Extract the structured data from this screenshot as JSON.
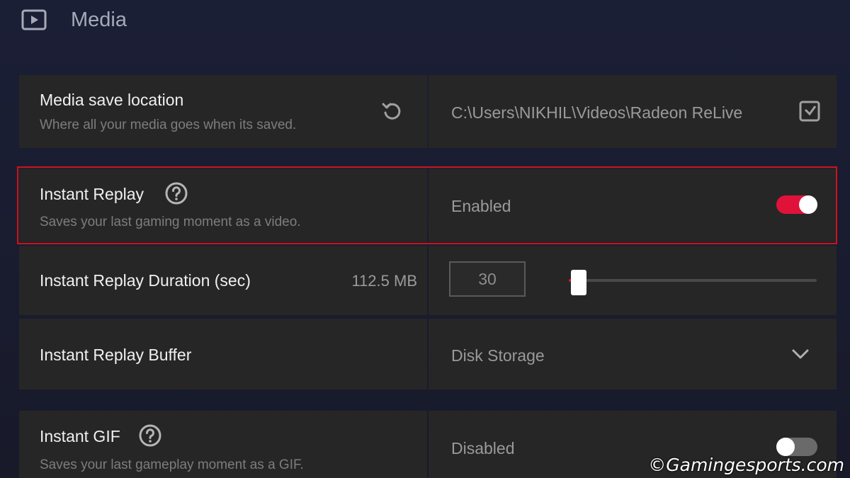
{
  "section": {
    "title": "Media",
    "icon": "play-icon"
  },
  "media_save": {
    "title": "Media save location",
    "subtitle": "Where all your media goes when its saved.",
    "reset_icon": "reset-icon",
    "path": "C:\\Users\\NIKHIL\\Videos\\Radeon ReLive",
    "browse_icon": "folder-browse-icon"
  },
  "instant_replay": {
    "title": "Instant Replay",
    "subtitle": "Saves your last gaming moment as a video.",
    "help_icon": "help-icon",
    "status": "Enabled",
    "toggle_on": true,
    "toggle_color": "#e0123a"
  },
  "replay_duration": {
    "title": "Instant Replay Duration (sec)",
    "size": "112.5 MB",
    "value": "30",
    "slider_fraction": 0.04
  },
  "replay_buffer": {
    "title": "Instant Replay Buffer",
    "value": "Disk Storage",
    "dropdown_icon": "chevron-down-icon"
  },
  "instant_gif": {
    "title": "Instant GIF",
    "subtitle": "Saves your last gameplay moment as a GIF.",
    "help_icon": "help-icon",
    "status": "Disabled",
    "toggle_on": false
  },
  "highlight_color": "#d0121b",
  "watermark": "©Gamingesports.com"
}
